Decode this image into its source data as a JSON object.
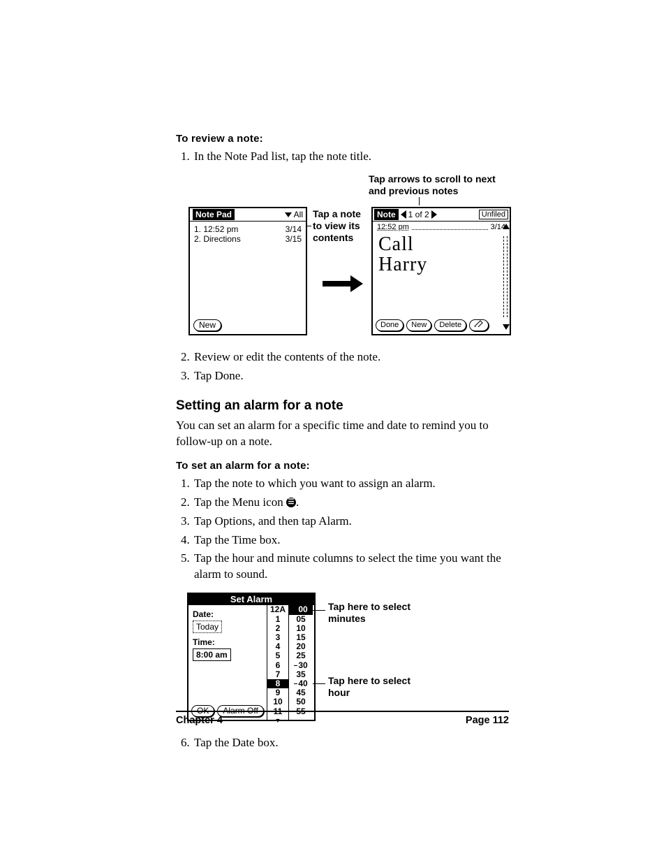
{
  "sec1": {
    "heading": "To review a note:",
    "steps": [
      "In the Note Pad list, tap the note title.",
      "Review or edit the contents of the note.",
      "Tap Done."
    ]
  },
  "fig1": {
    "callout_top": "Tap arrows to scroll to next and previous notes",
    "callout_mid": "Tap a note to view its contents",
    "left": {
      "title": "Note Pad",
      "category": "All",
      "items": [
        {
          "label": "1.  12:52 pm",
          "date": "3/14"
        },
        {
          "label": "2.  Directions",
          "date": "3/15"
        }
      ],
      "new_btn": "New"
    },
    "right": {
      "title": "Note",
      "counter": "1 of 2",
      "category": "Unfiled",
      "time": "12:52 pm",
      "date": "3/14",
      "handwriting1": "Call",
      "handwriting2": "Harry",
      "btn_done": "Done",
      "btn_new": "New",
      "btn_delete": "Delete"
    }
  },
  "sec2": {
    "heading": "Setting an alarm for a note",
    "para": "You can set an alarm for a specific time and date to remind you to follow-up on a note."
  },
  "sec3": {
    "heading": "To set an alarm for a note:",
    "steps": [
      "Tap the note to which you want to assign an alarm.",
      "Tap the Menu icon ",
      "Tap Options, and then tap Alarm.",
      "Tap the Time box.",
      "Tap the hour and minute columns to select the time you want the alarm to sound.",
      "Tap the Date box."
    ],
    "menu_icon_suffix": "."
  },
  "alarm": {
    "title": "Set Alarm",
    "date_label": "Date:",
    "date_value": "Today",
    "time_label": "Time:",
    "time_value": "8:00 am",
    "ok": "OK",
    "off": "Alarm Off",
    "hours": [
      "12A",
      "1",
      "2",
      "3",
      "4",
      "5",
      "6",
      "7",
      "8",
      "9",
      "10",
      "11"
    ],
    "hour_selected_index": 8,
    "minutes": [
      "00",
      "05",
      "10",
      "15",
      "20",
      "25",
      "30",
      "35",
      "40",
      "45",
      "50",
      "55"
    ],
    "minute_selected_index": 0,
    "callout_minutes": "Tap here to select minutes",
    "callout_hour": "Tap here to select hour"
  },
  "footer": {
    "left": "Chapter 4",
    "right": "Page 112"
  }
}
